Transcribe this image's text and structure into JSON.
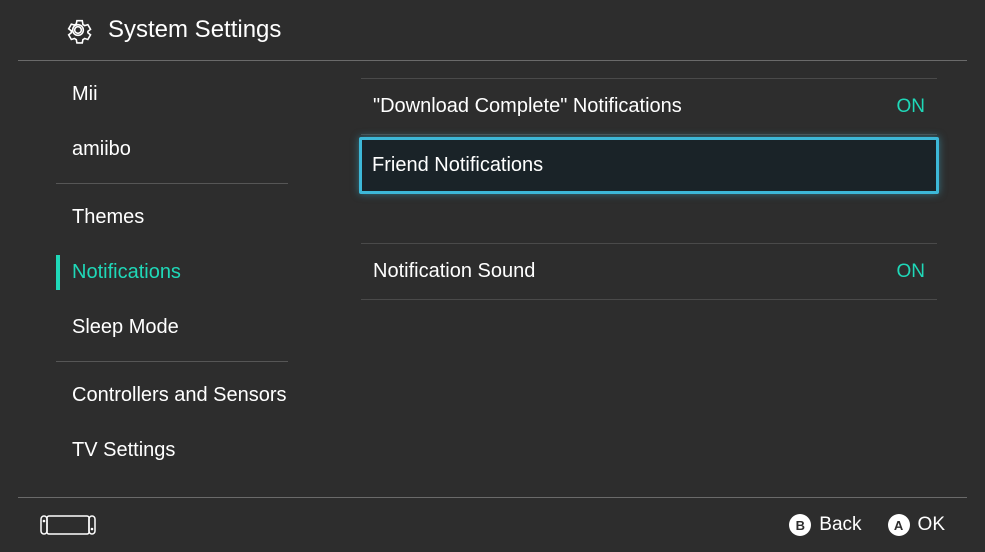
{
  "header": {
    "title": "System Settings"
  },
  "sidebar": {
    "items": [
      {
        "label": "Mii",
        "active": false
      },
      {
        "label": "amiibo",
        "active": false
      },
      {
        "label": "Themes",
        "active": false
      },
      {
        "label": "Notifications",
        "active": true
      },
      {
        "label": "Sleep Mode",
        "active": false
      },
      {
        "label": "Controllers and Sensors",
        "active": false
      },
      {
        "label": "TV Settings",
        "active": false
      }
    ]
  },
  "main": {
    "rows": [
      {
        "label": "\"Download Complete\" Notifications",
        "value": "ON",
        "selected": false
      },
      {
        "label": "Friend Notifications",
        "value": "",
        "selected": true
      },
      {
        "label": "Notification Sound",
        "value": "ON",
        "selected": false
      }
    ]
  },
  "footer": {
    "back": {
      "glyph": "B",
      "label": "Back"
    },
    "ok": {
      "glyph": "A",
      "label": "OK"
    }
  }
}
